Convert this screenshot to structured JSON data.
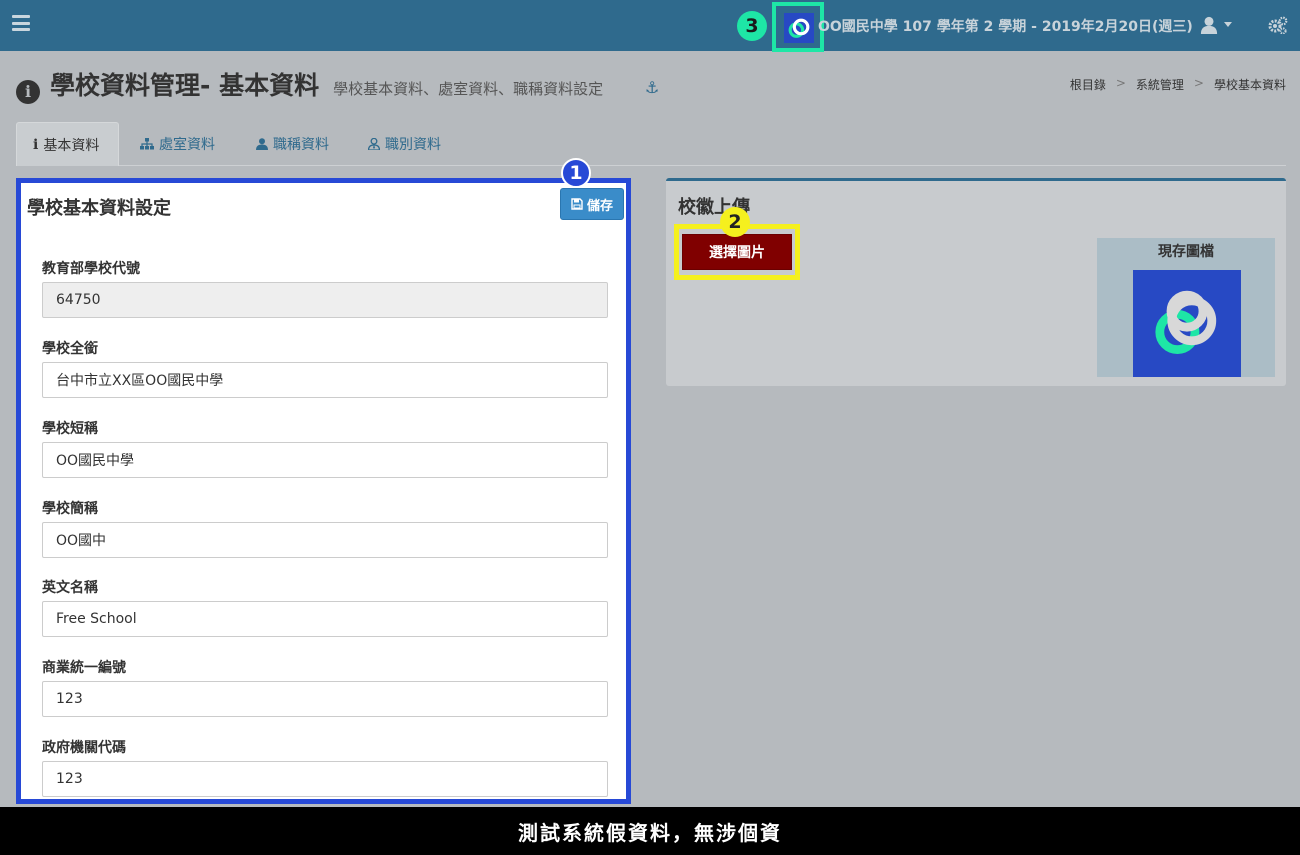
{
  "navbar": {
    "school_info": "OO國民中學 107 學年第 2 學期 - 2019年2月20日(週三)"
  },
  "badges": [
    "1",
    "2",
    "3"
  ],
  "page": {
    "title": "學校資料管理- 基本資料",
    "subtitle": "學校基本資料、處室資料、職稱資料設定",
    "title_icon": "i"
  },
  "breadcrumb": [
    "根目錄",
    "系統管理",
    "學校基本資料"
  ],
  "tabs": [
    {
      "label": "基本資料",
      "icon": "info-icon",
      "glyph": "ℹ"
    },
    {
      "label": "處室資料",
      "icon": "sitemap-icon",
      "glyph": "⚯"
    },
    {
      "label": "職稱資料",
      "icon": "user-icon",
      "glyph": "👤"
    },
    {
      "label": "職別資料",
      "icon": "user-tie-icon",
      "glyph": "♙"
    }
  ],
  "form": {
    "title": "學校基本資料設定",
    "save_label": "儲存",
    "fields": [
      {
        "label": "教育部學校代號",
        "value": "64750"
      },
      {
        "label": "學校全銜",
        "value": "台中市立XX區OO國民中學"
      },
      {
        "label": "學校短稱",
        "value": "OO國民中學"
      },
      {
        "label": "學校簡稱",
        "value": "OO國中"
      },
      {
        "label": "英文名稱",
        "value": "Free School"
      },
      {
        "label": "商業統一編號",
        "value": "123"
      },
      {
        "label": "政府機關代碼",
        "value": "123"
      }
    ]
  },
  "upload": {
    "title": "校徽上傳",
    "choose_label": "選擇圖片",
    "current_label": "現存圖檔"
  },
  "caption": "測試系統假資料，無涉個資",
  "colors": {
    "navbar": "#2f6a8d",
    "panel_highlight": "#2749d6",
    "upload_highlight": "#f5f01e",
    "logo_highlight": "#1ee6a6",
    "choose_button": "#800000"
  }
}
